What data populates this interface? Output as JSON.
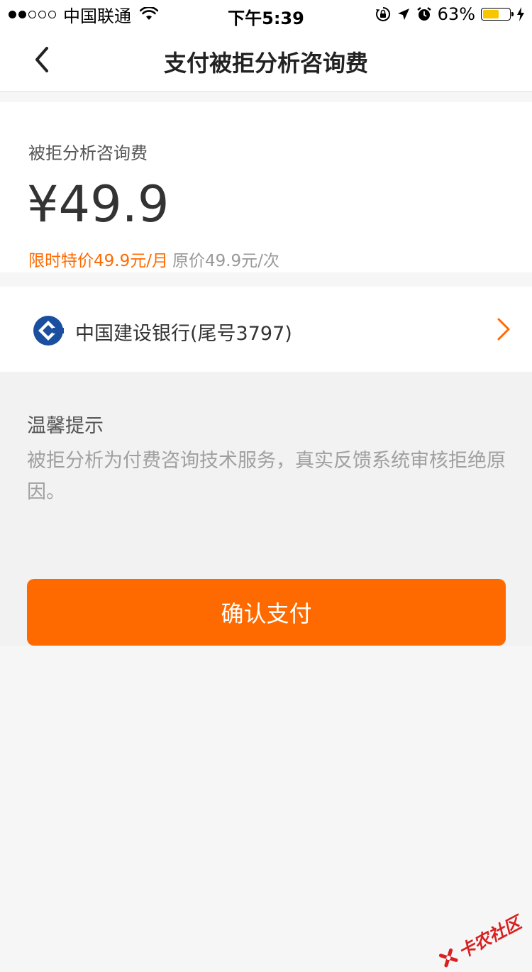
{
  "status_bar": {
    "carrier": "中国联通",
    "time": "下午5:39",
    "battery_percent": "63%",
    "battery_level": 0.63,
    "icons": [
      "signal-dots",
      "wifi-icon",
      "rotation-lock-icon",
      "location-arrow-icon",
      "alarm-icon",
      "battery-icon",
      "charging-bolt-icon"
    ]
  },
  "nav": {
    "title": "支付被拒分析咨询费",
    "back_icon": "chevron-left-icon"
  },
  "fee": {
    "label": "被拒分析咨询费",
    "amount": "¥49.9",
    "promo_price": "限时特价49.9元/月",
    "original_price": "原价49.9元/次"
  },
  "payment_method": {
    "bank_name": "中国建设银行(尾号3797)",
    "logo_icon": "ccb-bank-logo-icon",
    "logo_color": "#1a4fa0",
    "chevron_icon": "chevron-right-icon",
    "chevron_color": "#ff6a00"
  },
  "tips": {
    "title": "温馨提示",
    "body": "被拒分析为付费咨询技术服务，真实反馈系统审核拒绝原因。"
  },
  "actions": {
    "confirm_label": "确认支付",
    "confirm_color": "#ff6a00"
  },
  "watermark": {
    "text": "卡农社区"
  }
}
